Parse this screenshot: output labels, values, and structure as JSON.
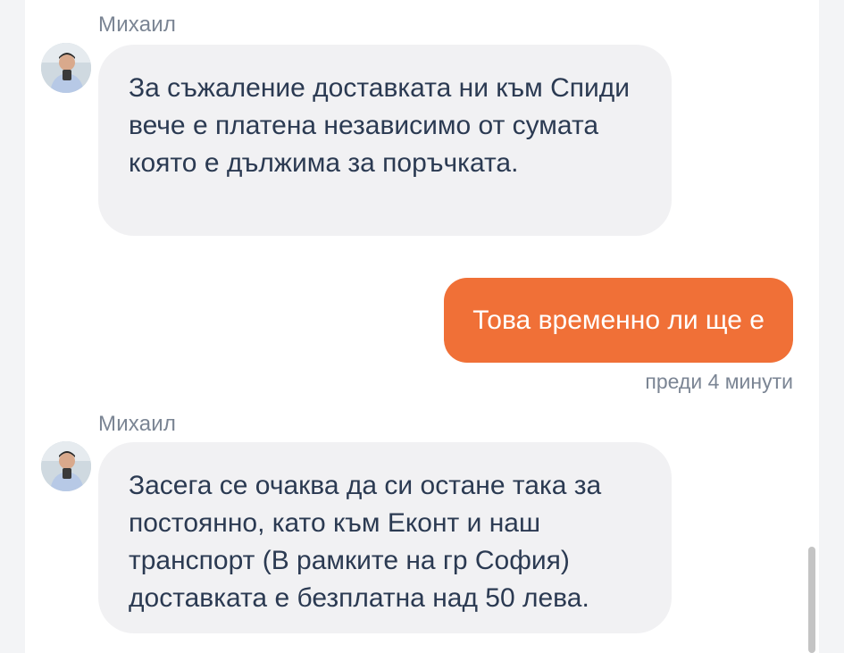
{
  "messages": [
    {
      "sender": "Михаил",
      "avatar_icon": "user-avatar-photo",
      "text": "За съжаление доставката ни към Спиди вече е платена независимо от сумата която е дължима за поръчката."
    },
    {
      "sender": "me",
      "text": "Това временно ли ще е",
      "timestamp": "преди 4 минути"
    },
    {
      "sender": "Михаил",
      "avatar_icon": "user-avatar-photo",
      "text": "Засега се очаква да си остане така за постоянно, като към Еконт и наш транспорт (В рамките на гр София) доставката е безплатна над 50 лева."
    }
  ],
  "colors": {
    "outgoing_bubble": "#f07037",
    "incoming_bubble": "#f1f1f3",
    "incoming_text": "#2b3a52",
    "meta_text": "#7b8594"
  }
}
